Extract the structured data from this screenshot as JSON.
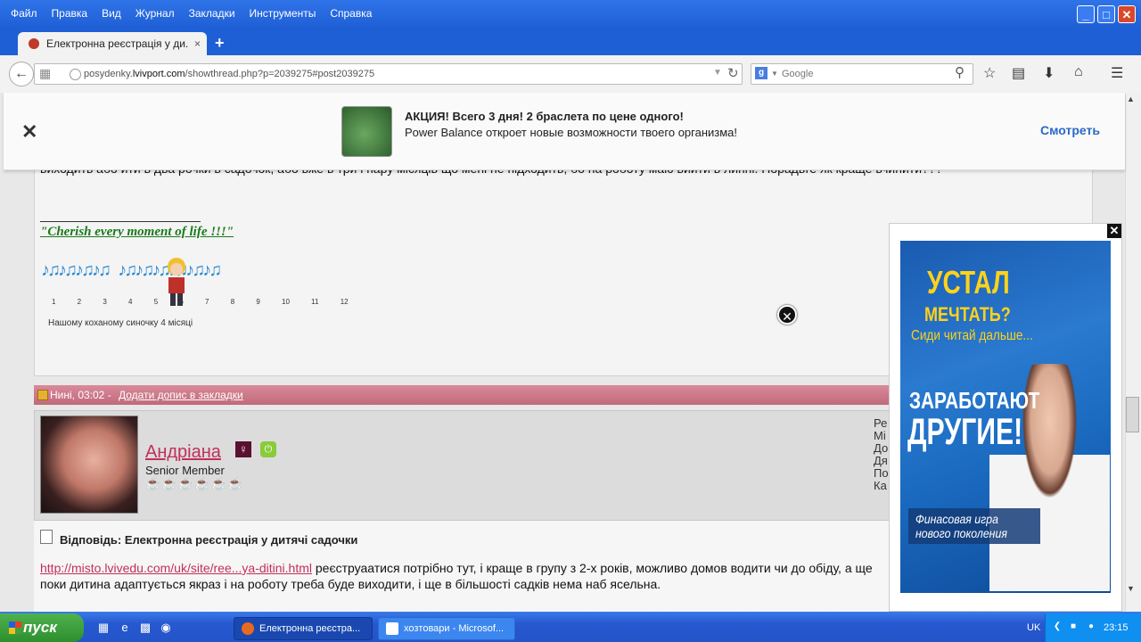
{
  "menu": [
    "Файл",
    "Правка",
    "Вид",
    "Журнал",
    "Закладки",
    "Инструменты",
    "Справка"
  ],
  "window_controls": {
    "minimize": "_",
    "maximize": "□",
    "close": "✕"
  },
  "tab": {
    "title": "Електронна реєстрація у ди...",
    "close": "×",
    "new_tab": "+"
  },
  "url": {
    "prefix": "posydenky.",
    "domain": "lvivport.com",
    "path": "/showthread.php?p=2039275#post2039275"
  },
  "search": {
    "placeholder": "Google",
    "engine": "g"
  },
  "banner": {
    "close": "✕",
    "title": "АКЦИЯ! Всего 3 дня! 2 браслета по цене одного!",
    "subtitle": "Power Balance откроет новые возможности твоего организма!",
    "cta": "Смотреть"
  },
  "post_top": {
    "text": "виходить або йти в два рочки в садочок, або вже в три і пару місяців що мені не підходить, бо на роботу маю вийти в липні. Порадьте як краще вчинити???",
    "signature": "\"Cherish every moment of life !!!\"",
    "ticker_numbers": "1 2 3 4 5 6 7 8 9 10 11 12",
    "ticker_caption": "Нашому коханому синочку 4 місяці"
  },
  "post_header": {
    "date": "Нині, 03:02 -",
    "bookmark_link": "Додати допис в закладки"
  },
  "user": {
    "name": "Андріана",
    "rank": "Senior Member",
    "gender_icon": "♀",
    "online_icon": "⏻",
    "cups": "☕☕☕☕☕☕",
    "stats": [
      "Ре",
      "Мі",
      "До",
      "Дя",
      "По",
      "Ка"
    ]
  },
  "reply": {
    "title": "Відповідь: Електронна реєстрація у дитячі садочки",
    "link": "http://misto.lvivedu.com/uk/site/ree...ya-ditini.html",
    "text": " реєструаатися потрібно тут, і краще в групу з 2-х років, можливо домов водити чи до обіду, а ще поки дитина адаптується якраз і на роботу треба буде виходити, і ще в більшості садків нема наб ясельна."
  },
  "ad": {
    "close": "✕",
    "headline1": "УСТАЛ",
    "headline2": "МЕЧТАТЬ?",
    "sub": "Сиди читай дальше...",
    "headline3": "ЗАРАБОТАЮТ",
    "headline4": "ДРУГИЕ!",
    "box": "Финасовая игра нового поколения"
  },
  "taskbar": {
    "start": "пуск",
    "tasks": [
      {
        "label": "Електронна реєстра..."
      },
      {
        "label": "хозтовари - Microsof..."
      }
    ],
    "lang": "UK",
    "time": "23:15"
  },
  "colors": {
    "titlebar": "#2f73e8",
    "accent_link": "#c0305a",
    "cta": "#2a6ac8",
    "signature": "#1a7a1a"
  }
}
